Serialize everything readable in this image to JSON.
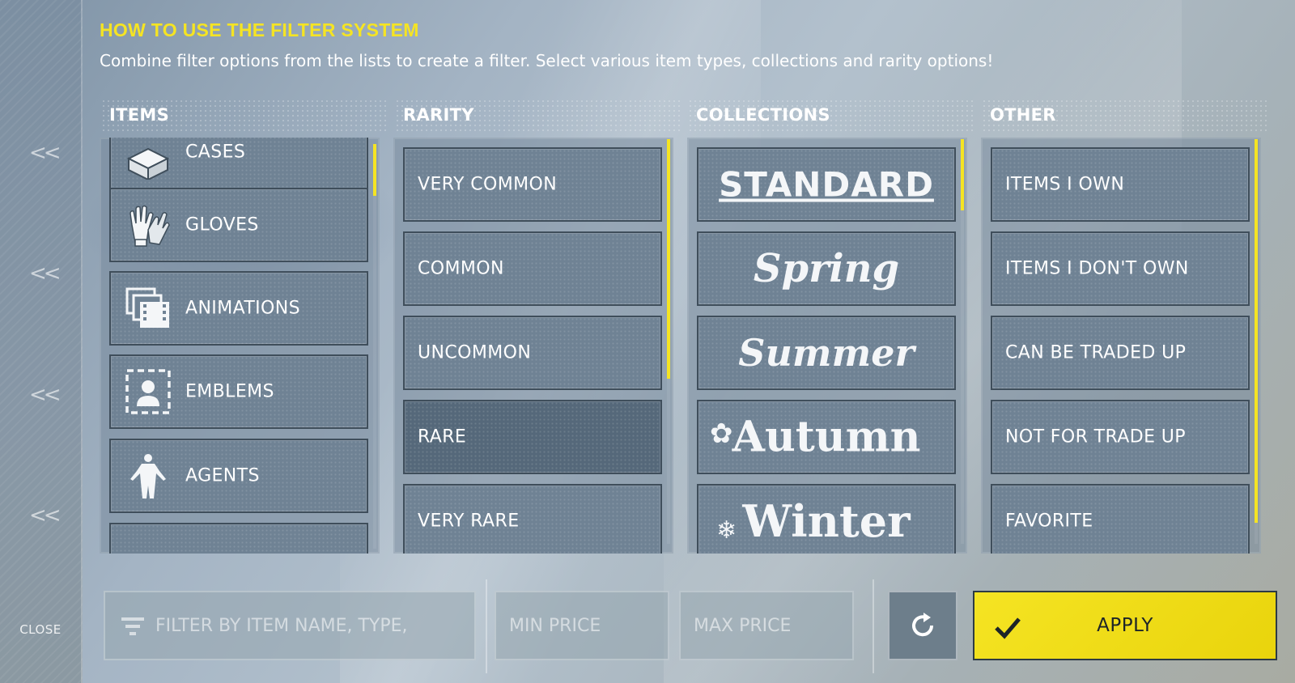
{
  "help": {
    "title": "HOW TO USE THE FILTER SYSTEM",
    "text": "Combine filter options from the lists to create a filter. Select various item types, collections and rarity options!"
  },
  "sidebar": {
    "close_label": "CLOSE",
    "chevron": "<<",
    "chevron_icon": "double-chevron-left-icon"
  },
  "columns": {
    "items": {
      "header": "ITEMS",
      "entries": [
        {
          "label": "CASES",
          "icon": "case-icon"
        },
        {
          "label": "GLOVES",
          "icon": "gloves-icon"
        },
        {
          "label": "ANIMATIONS",
          "icon": "animations-icon"
        },
        {
          "label": "EMBLEMS",
          "icon": "emblem-icon"
        },
        {
          "label": "AGENTS",
          "icon": "agent-icon"
        }
      ]
    },
    "rarity": {
      "header": "RARITY",
      "entries": [
        {
          "label": "VERY COMMON"
        },
        {
          "label": "COMMON"
        },
        {
          "label": "UNCOMMON"
        },
        {
          "label": "RARE",
          "selected": true
        },
        {
          "label": "VERY RARE"
        }
      ]
    },
    "collections": {
      "header": "COLLECTIONS",
      "entries": [
        {
          "label": "STANDARD"
        },
        {
          "label": "Spring"
        },
        {
          "label": "Summer"
        },
        {
          "label": "Autumn"
        },
        {
          "label": "Winter"
        }
      ]
    },
    "other": {
      "header": "OTHER",
      "entries": [
        {
          "label": "ITEMS I OWN"
        },
        {
          "label": "ITEMS I DON'T OWN"
        },
        {
          "label": "CAN BE TRADED UP"
        },
        {
          "label": "NOT FOR TRADE UP"
        },
        {
          "label": "FAVORITE"
        }
      ]
    }
  },
  "bottom_bar": {
    "search_placeholder": "FILTER BY ITEM NAME, TYPE,",
    "min_price_placeholder": "MIN PRICE",
    "max_price_placeholder": "MAX PRICE",
    "reset_icon": "refresh-icon",
    "apply_label": "APPLY",
    "apply_icon": "checkmark-icon"
  },
  "colors": {
    "accent_yellow": "#f5e423",
    "tile_bg": "#6f8294",
    "tile_selected_bg": "#55687a",
    "tile_border": "#3f4e5b"
  }
}
